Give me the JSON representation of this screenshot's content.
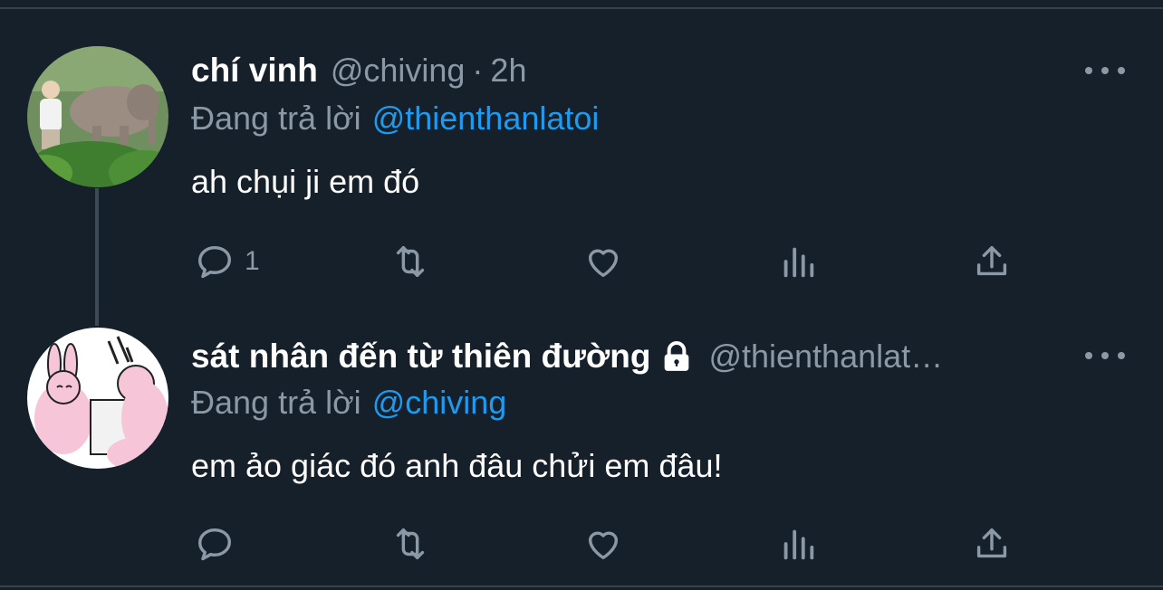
{
  "tweets": [
    {
      "display_name": "chí vinh",
      "handle": "@chiving",
      "separator": "·",
      "time": "2h",
      "replying_label": "Đang trả lời",
      "replying_to": "@thienthanlatoi",
      "text": "ah chụi ji em đó",
      "reply_count": "1",
      "locked": false
    },
    {
      "display_name": "sát nhân đến từ thiên đường",
      "handle": "@thienthanlat…",
      "replying_label": "Đang trả lời",
      "replying_to": "@chiving",
      "text": "em ảo giác đó anh đâu chửi em đâu!",
      "reply_count": "",
      "locked": true
    }
  ],
  "icons": {
    "reply": "reply-icon",
    "retweet": "retweet-icon",
    "like": "heart-icon",
    "views": "analytics-icon",
    "share": "share-icon",
    "more": "more-icon",
    "lock": "lock-icon"
  },
  "colors": {
    "background": "#15202b",
    "text": "#ffffff",
    "secondary": "#8b98a5",
    "accent": "#1d9bf0",
    "divider": "#38444d"
  }
}
